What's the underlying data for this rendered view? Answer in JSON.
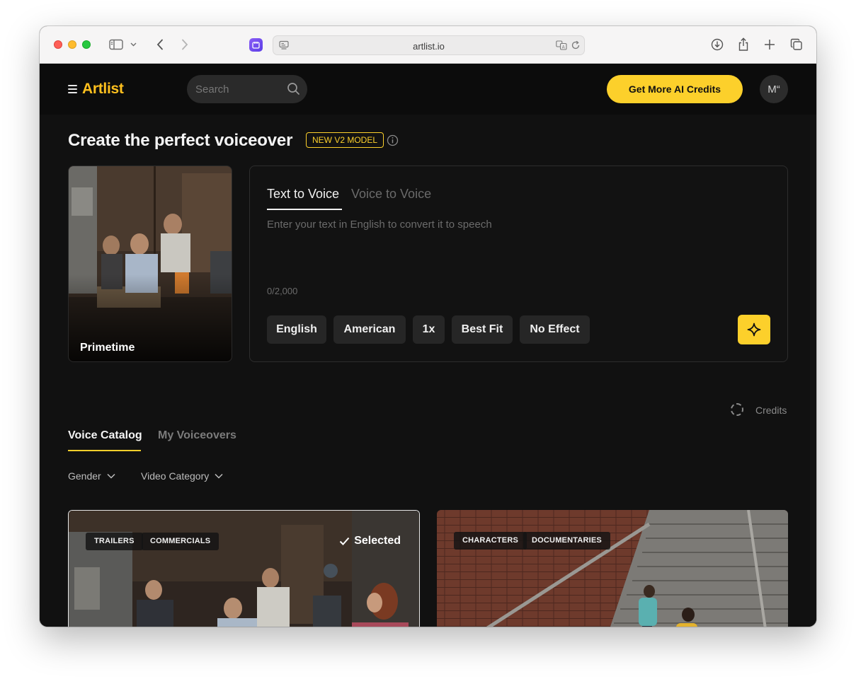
{
  "browser": {
    "url": "artlist.io"
  },
  "header": {
    "logo": "Artlist",
    "search_placeholder": "Search",
    "cta_label": "Get More AI Credits",
    "avatar_initials": "M“"
  },
  "page": {
    "title": "Create the perfect voiceover",
    "model_badge": "NEW V2 MODEL"
  },
  "voice_card": {
    "name": "Primetime"
  },
  "editor": {
    "tabs": [
      "Text to Voice",
      "Voice to Voice"
    ],
    "active_tab": "Text to Voice",
    "placeholder": "Enter your text in English to convert it to speech",
    "counter": "0/2,000",
    "options": [
      "English",
      "American",
      "1x",
      "Best Fit",
      "No Effect"
    ]
  },
  "credits": {
    "label": "Credits"
  },
  "catalog": {
    "tabs": [
      "Voice Catalog",
      "My Voiceovers"
    ],
    "active_tab": "Voice Catalog",
    "filters": [
      "Gender",
      "Video Category"
    ],
    "cards": [
      {
        "tags": [
          "TRAILERS",
          "COMMERCIALS"
        ],
        "status": "Selected"
      },
      {
        "tags": [
          "CHARACTERS",
          "DOCUMENTARIES"
        ],
        "status": ""
      }
    ]
  },
  "colors": {
    "accent": "#fcd02b",
    "background": "#111111",
    "header": "#0c0c0c"
  }
}
